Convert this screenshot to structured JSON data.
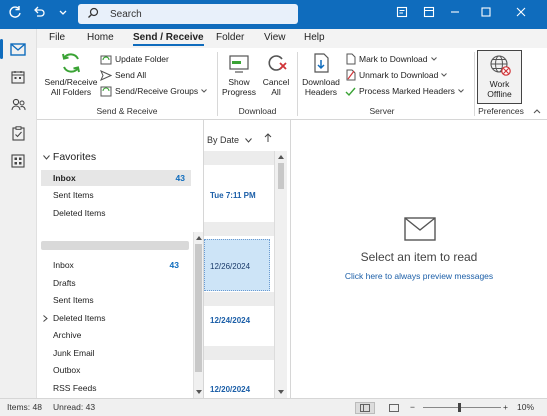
{
  "titlebar": {
    "search": {
      "placeholder": "Search"
    }
  },
  "tabs": [
    {
      "label": "File"
    },
    {
      "label": "Home"
    },
    {
      "label": "Send / Receive"
    },
    {
      "label": "Folder"
    },
    {
      "label": "View"
    },
    {
      "label": "Help"
    }
  ],
  "ribbon": {
    "send_receive": {
      "all_folders": "Send/Receive\nAll Folders",
      "update_folder": "Update Folder",
      "send_all": "Send All",
      "groups": "Send/Receive Groups",
      "label": "Send & Receive"
    },
    "download": {
      "show_progress": "Show\nProgress",
      "cancel_all": "Cancel\nAll",
      "label": "Download"
    },
    "server": {
      "download_headers": "Download\nHeaders",
      "mark_to_download": "Mark to Download",
      "unmark_to_download": "Unmark to Download",
      "process_marked": "Process Marked Headers",
      "label": "Server"
    },
    "preferences": {
      "work_offline": "Work\nOffline",
      "label": "Preferences"
    }
  },
  "folders": {
    "favorites_header": "Favorites",
    "favorites": [
      {
        "name": "Inbox",
        "count": "43"
      },
      {
        "name": "Sent Items",
        "count": ""
      },
      {
        "name": "Deleted Items",
        "count": ""
      }
    ],
    "account": [
      {
        "name": "Inbox",
        "count": "43"
      },
      {
        "name": "Drafts",
        "count": ""
      },
      {
        "name": "Sent Items",
        "count": ""
      },
      {
        "name": "Deleted Items",
        "count": ""
      },
      {
        "name": "Archive",
        "count": ""
      },
      {
        "name": "Junk Email",
        "count": ""
      },
      {
        "name": "Outbox",
        "count": ""
      },
      {
        "name": "RSS Feeds",
        "count": ""
      }
    ]
  },
  "mail_list": {
    "sort_label": "By Date",
    "dates": [
      "Tue 7:11 PM",
      "12/26/2024",
      "12/24/2024",
      "12/20/2024"
    ]
  },
  "reading_pane": {
    "title": "Select an item to read",
    "link": "Click here to always preview messages"
  },
  "status": {
    "items": "Items: 48",
    "unread": "Unread: 43",
    "zoom": "10%"
  },
  "colors": {
    "accent": "#0f6cbd",
    "link": "#1c5fa8"
  }
}
